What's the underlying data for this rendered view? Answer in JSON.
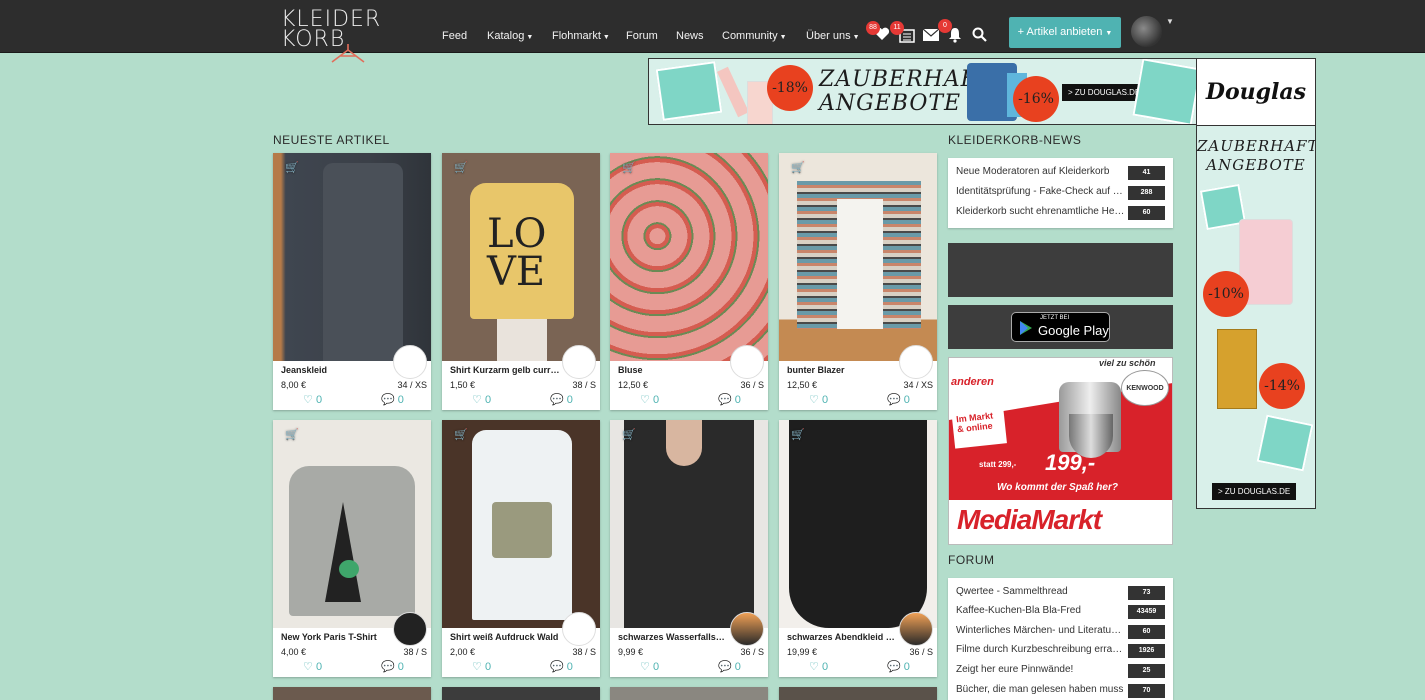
{
  "nav": {
    "logo_line1": "KLEIDER",
    "logo_line2": "KORB",
    "links": [
      "Feed",
      "Katalog",
      "Flohmarkt",
      "Forum",
      "News",
      "Community",
      "Über uns"
    ],
    "badges": {
      "favorites": "88",
      "news": "11",
      "messages": "0"
    },
    "offer_button": "+ Artikel anbieten",
    "colors": {
      "bar": "#2d2d2d",
      "accent": "#4fb3b2",
      "badge": "#e53935",
      "page_bg": "#b3ddcb"
    }
  },
  "ads": {
    "top": {
      "discount1": "-18%",
      "line1": "ZAUBERHAFTE",
      "line2": "ANGEBOTE",
      "discount2": "-16%",
      "cta": "ZU DOUGLAS.DE"
    },
    "side": {
      "brand": "Douglas",
      "line1": "ZAUBERHAFTE",
      "line2": "ANGEBOTE",
      "discount1": "-10%",
      "discount2": "-14%",
      "cta": "ZU DOUGLAS.DE"
    },
    "mediamarkt": {
      "tag": "KENWOOD",
      "top_text": "viel zu schön",
      "left_text": "anderen",
      "badge": "Im Markt & online",
      "statt": "statt 299,-",
      "price": "199,-",
      "slogan": "Wo kommt der Spaß her?",
      "brand": "MediaMarkt"
    }
  },
  "main": {
    "heading": "NEUESTE ARTIKEL",
    "products": [
      {
        "title": "Jeanskleid",
        "price": "8,00 €",
        "size": "34 / XS",
        "likes": "0",
        "comments": "0"
      },
      {
        "title": "Shirt Kurzarm gelb curry LOVE",
        "price": "1,50 €",
        "size": "38 / S",
        "likes": "0",
        "comments": "0"
      },
      {
        "title": "Bluse",
        "price": "12,50 €",
        "size": "36 / S",
        "likes": "0",
        "comments": "0"
      },
      {
        "title": "bunter Blazer",
        "price": "12,50 €",
        "size": "34 / XS",
        "likes": "0",
        "comments": "0"
      },
      {
        "title": "New York Paris T-Shirt",
        "price": "4,00 €",
        "size": "38 / S",
        "likes": "0",
        "comments": "0"
      },
      {
        "title": "Shirt weiß Aufdruck Wald",
        "price": "2,00 €",
        "size": "38 / S",
        "likes": "0",
        "comments": "0"
      },
      {
        "title": "schwarzes Wasserfallshirt",
        "price": "9,99 €",
        "size": "36 / S",
        "likes": "0",
        "comments": "0"
      },
      {
        "title": "schwarzes Abendkleid kurz",
        "price": "19,99 €",
        "size": "36 / S",
        "likes": "0",
        "comments": "0"
      }
    ]
  },
  "sidebar": {
    "news_heading": "KLEIDERKORB-NEWS",
    "news": [
      {
        "title": "Neue Moderatoren auf Kleiderkorb",
        "count": "41"
      },
      {
        "title": "Identitätsprüfung - Fake-Check auf Kleiderkorb",
        "count": "288"
      },
      {
        "title": "Kleiderkorb sucht ehrenamtliche Helfer",
        "count": "60"
      }
    ],
    "gplay_small": "JETZT BEI",
    "gplay_big": "Google Play",
    "forum_heading": "FORUM",
    "forum": [
      {
        "title": "Qwertee - Sammelthread",
        "count": "73"
      },
      {
        "title": "Kaffee-Kuchen-Bla Bla-Fred",
        "count": "43459"
      },
      {
        "title": "Winterliches Märchen- und Literaturrätsel",
        "count": "60"
      },
      {
        "title": "Filme durch Kurzbeschreibung erraten",
        "count": "1926"
      },
      {
        "title": "Zeigt her eure Pinnwände!",
        "count": "25"
      },
      {
        "title": "Bücher, die man gelesen haben muss",
        "count": "70"
      }
    ]
  }
}
